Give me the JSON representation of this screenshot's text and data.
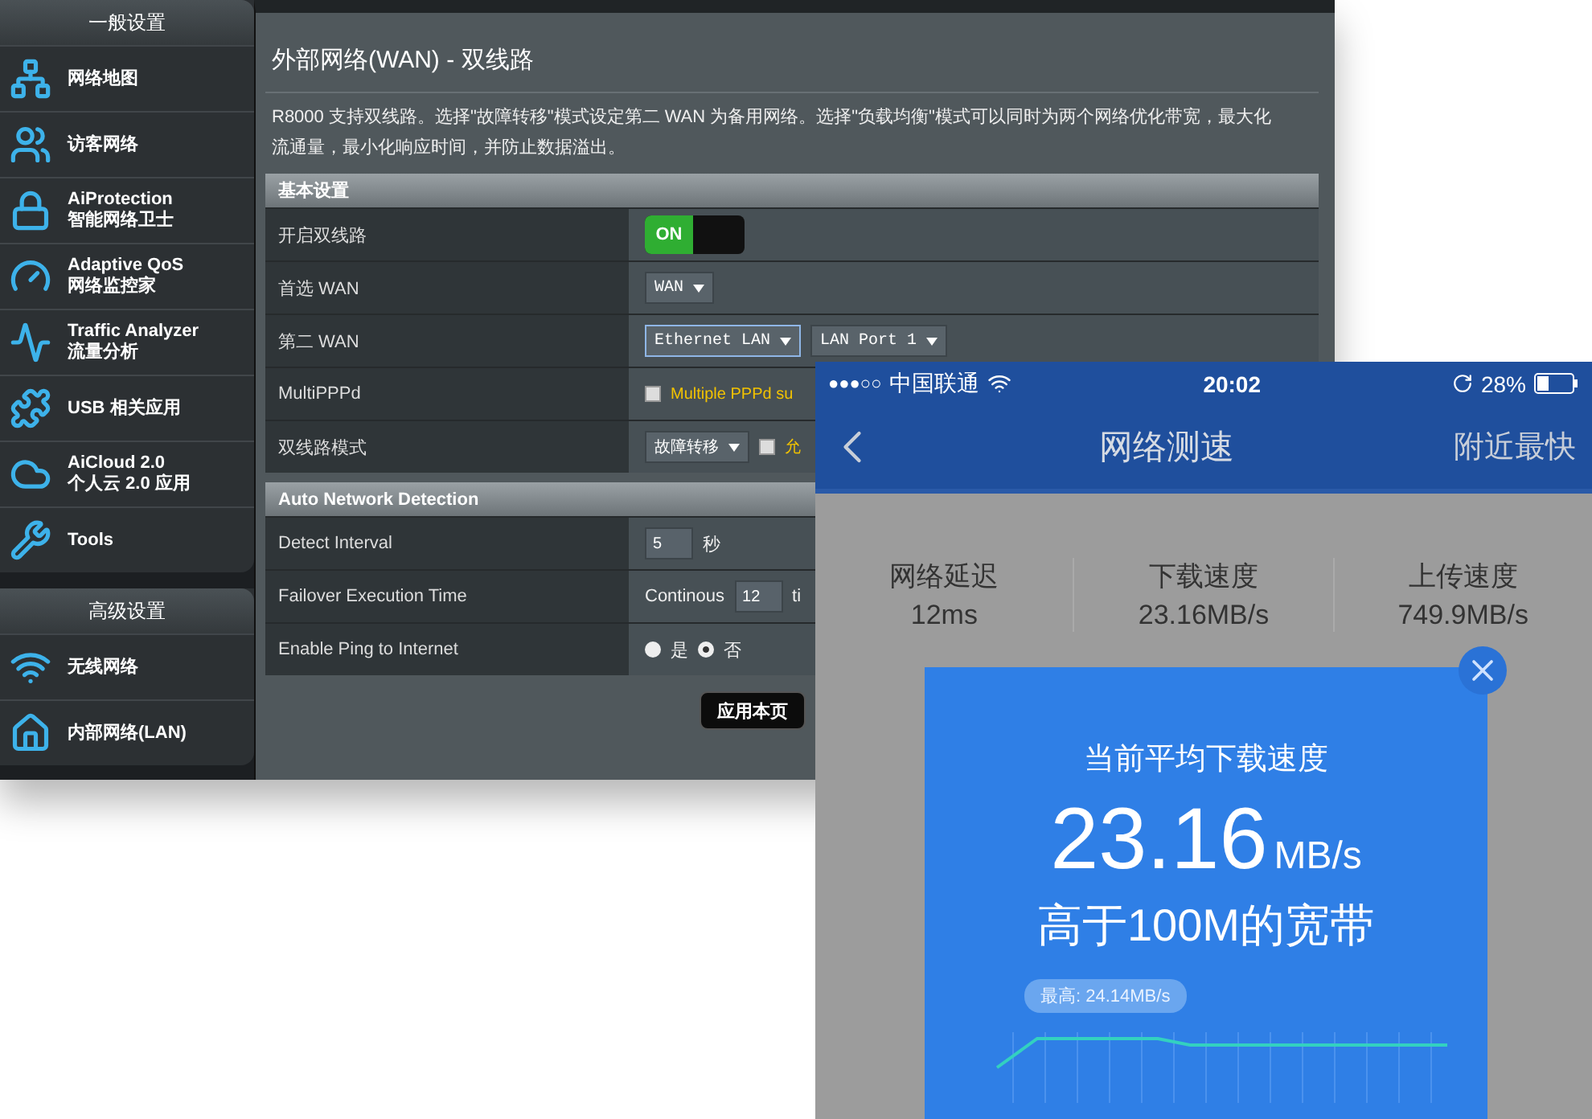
{
  "router": {
    "sidebar": {
      "sections": [
        {
          "title": "一般设置",
          "items": [
            {
              "label": "网络地图"
            },
            {
              "label": "访客网络"
            },
            {
              "label": "AiProtection",
              "sublabel": "智能网络卫士"
            },
            {
              "label": "Adaptive QoS",
              "sublabel": "网络监控家"
            },
            {
              "label": "Traffic Analyzer",
              "sublabel": "流量分析"
            },
            {
              "label": "USB 相关应用"
            },
            {
              "label": "AiCloud 2.0",
              "sublabel": "个人云 2.0 应用"
            },
            {
              "label": "Tools"
            }
          ]
        },
        {
          "title": "高级设置",
          "items": [
            {
              "label": "无线网络"
            },
            {
              "label": "内部网络(LAN)"
            }
          ]
        }
      ]
    },
    "title": "外部网络(WAN) - 双线路",
    "description": "R8000 支持双线路。选择\"故障转移\"模式设定第二 WAN 为备用网络。选择\"负载均衡\"模式可以同时为两个网络优化带宽，最大化流通量，最小化响应时间，并防止数据溢出。",
    "sections": [
      {
        "title": "基本设置",
        "rows": [
          {
            "label": "开启双线路",
            "controls": [
              {
                "kind": "toggle",
                "on": true,
                "label": "ON"
              }
            ]
          },
          {
            "label": "首选 WAN",
            "controls": [
              {
                "kind": "select",
                "value": "WAN"
              }
            ]
          },
          {
            "label": "第二 WAN",
            "controls": [
              {
                "kind": "select",
                "value": "Ethernet LAN",
                "focused": true
              },
              {
                "kind": "select",
                "value": "LAN Port 1"
              }
            ]
          },
          {
            "label": "MultiPPPd",
            "controls": [
              {
                "kind": "checkbox",
                "checked": false,
                "label": "Multiple PPPd su"
              }
            ]
          },
          {
            "label": "双线路模式",
            "controls": [
              {
                "kind": "select",
                "value": "故障转移"
              },
              {
                "kind": "checkbox",
                "checked": false,
                "label": "允"
              }
            ]
          }
        ]
      },
      {
        "title": "Auto Network Detection",
        "rows": [
          {
            "label": "Detect Interval",
            "controls": [
              {
                "kind": "input",
                "value": "5"
              },
              {
                "kind": "text",
                "text": "秒"
              }
            ]
          },
          {
            "label": "Failover Execution Time",
            "controls": [
              {
                "kind": "text",
                "text": "Continous"
              },
              {
                "kind": "input",
                "value": "12"
              },
              {
                "kind": "text",
                "text": "ti"
              }
            ]
          },
          {
            "label": "Enable Ping to Internet",
            "controls": [
              {
                "kind": "radio",
                "label": "是",
                "selected": false
              },
              {
                "kind": "radio",
                "label": "否",
                "selected": true
              }
            ]
          }
        ]
      }
    ],
    "apply_button": "应用本页"
  },
  "phone": {
    "status_bar": {
      "signal": "●●●○○",
      "carrier": "中国联通",
      "time": "20:02",
      "battery": "28%"
    },
    "nav": {
      "title": "网络测速",
      "action": "附近最快"
    },
    "stats": [
      {
        "label": "网络延迟",
        "value": "12ms"
      },
      {
        "label": "下载速度",
        "value": "23.16MB/s"
      },
      {
        "label": "上传速度",
        "value": "749.9MB/s"
      }
    ],
    "result": {
      "caption": "当前平均下载速度",
      "speed": "23.16",
      "unit": "MB/s",
      "comparison": "高于100M的宽带",
      "peak": "最高: 24.14MB/s"
    }
  }
}
